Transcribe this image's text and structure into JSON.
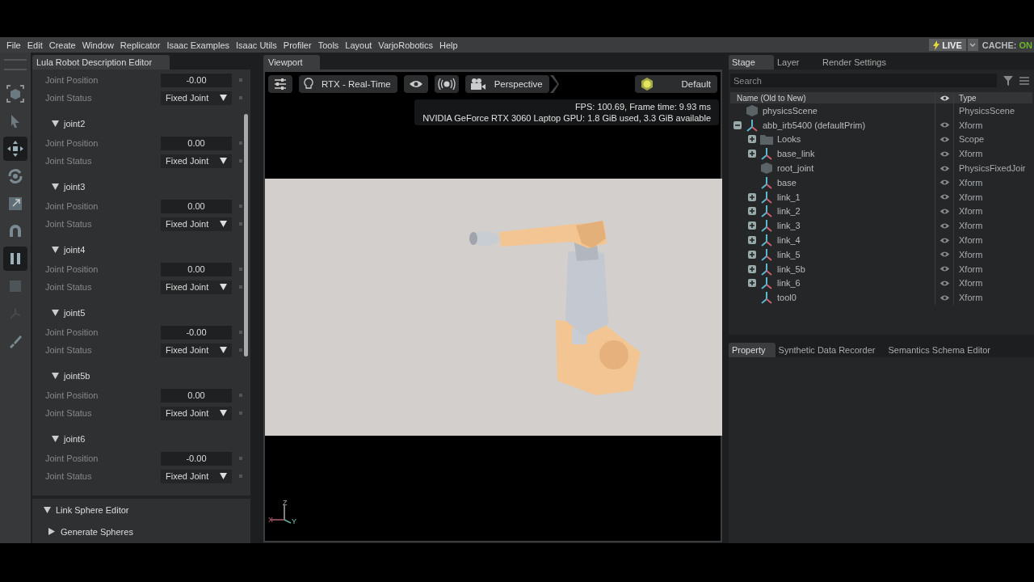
{
  "menu": [
    "File",
    "Edit",
    "Create",
    "Window",
    "Replicator",
    "Isaac Examples",
    "Isaac Utils",
    "Profiler",
    "Tools",
    "Layout",
    "VarjoRobotics",
    "Help"
  ],
  "live": {
    "label": "LIVE",
    "cache_label": "CACHE:",
    "cache_value": "ON"
  },
  "tools": [
    {
      "kind": "frame",
      "selected": false
    },
    {
      "kind": "select",
      "selected": false
    },
    {
      "kind": "move",
      "selected": true
    },
    {
      "kind": "rotate",
      "selected": false
    },
    {
      "kind": "scale",
      "selected": false
    },
    {
      "kind": "snap",
      "selected": false
    },
    {
      "kind": "pause",
      "selected": true
    },
    {
      "kind": "stop",
      "selected": false
    },
    {
      "kind": "joint",
      "selected": false
    },
    {
      "kind": "paint",
      "selected": false
    }
  ],
  "left_panel": {
    "title": "Lula Robot Description Editor",
    "rows": [
      {
        "kind": "number",
        "label": "Joint Position",
        "value": "-0.00"
      },
      {
        "kind": "dropdown",
        "label": "Joint Status",
        "value": "Fixed Joint"
      },
      {
        "kind": "header",
        "label": "joint2",
        "expanded": true
      },
      {
        "kind": "number",
        "label": "Joint Position",
        "value": "0.00"
      },
      {
        "kind": "dropdown",
        "label": "Joint Status",
        "value": "Fixed Joint"
      },
      {
        "kind": "header",
        "label": "joint3",
        "expanded": true
      },
      {
        "kind": "number",
        "label": "Joint Position",
        "value": "0.00"
      },
      {
        "kind": "dropdown",
        "label": "Joint Status",
        "value": "Fixed Joint"
      },
      {
        "kind": "header",
        "label": "joint4",
        "expanded": true
      },
      {
        "kind": "number",
        "label": "Joint Position",
        "value": "0.00"
      },
      {
        "kind": "dropdown",
        "label": "Joint Status",
        "value": "Fixed Joint"
      },
      {
        "kind": "header",
        "label": "joint5",
        "expanded": true
      },
      {
        "kind": "number",
        "label": "Joint Position",
        "value": "-0.00"
      },
      {
        "kind": "dropdown",
        "label": "Joint Status",
        "value": "Fixed Joint"
      },
      {
        "kind": "header",
        "label": "joint5b",
        "expanded": true
      },
      {
        "kind": "number",
        "label": "Joint Position",
        "value": "0.00"
      },
      {
        "kind": "dropdown",
        "label": "Joint Status",
        "value": "Fixed Joint"
      },
      {
        "kind": "header",
        "label": "joint6",
        "expanded": true
      },
      {
        "kind": "number",
        "label": "Joint Position",
        "value": "-0.00"
      },
      {
        "kind": "dropdown",
        "label": "Joint Status",
        "value": "Fixed Joint"
      }
    ],
    "sections": [
      {
        "label": "Link Sphere Editor",
        "expanded": true,
        "children": [
          {
            "label": "Generate Spheres",
            "expanded": false
          }
        ]
      }
    ]
  },
  "viewport": {
    "tab": "Viewport",
    "render_mode": "RTX - Real-Time",
    "camera": "Perspective",
    "lighting": "Default",
    "stats": [
      "FPS: 100.69, Frame time: 9.93 ms",
      "NVIDIA GeForce RTX 3060 Laptop GPU: 1.8 GiB used, 3.3 GiB available"
    ],
    "axes": {
      "z": "Z",
      "x": "X",
      "y": "Y"
    }
  },
  "stage": {
    "tabs": [
      {
        "label": "Stage",
        "selected": true
      },
      {
        "label": "Layer",
        "selected": false
      },
      {
        "label": "Render Settings",
        "selected": false
      }
    ],
    "search": {
      "placeholder": "Search"
    },
    "columns": {
      "name": "Name (Old to New)",
      "type": "Type"
    },
    "tree": [
      {
        "name": "physicsScene",
        "type": "PhysicsScene",
        "kind": "cube",
        "visible": false
      },
      {
        "name": "abb_irb5400 (defaultPrim)",
        "type": "Xform",
        "kind": "xform",
        "visible": true,
        "expanded": true,
        "children": [
          {
            "name": "Looks",
            "type": "Scope",
            "kind": "folder",
            "visible": true,
            "expanded": false
          },
          {
            "name": "base_link",
            "type": "Xform",
            "kind": "xform",
            "visible": true,
            "expanded": false
          },
          {
            "name": "root_joint",
            "type": "PhysicsFixedJoir",
            "kind": "cube",
            "visible": true
          },
          {
            "name": "base",
            "type": "Xform",
            "kind": "xform",
            "visible": true
          },
          {
            "name": "link_1",
            "type": "Xform",
            "kind": "xform",
            "visible": true,
            "expanded": false
          },
          {
            "name": "link_2",
            "type": "Xform",
            "kind": "xform",
            "visible": true,
            "expanded": false
          },
          {
            "name": "link_3",
            "type": "Xform",
            "kind": "xform",
            "visible": true,
            "expanded": false
          },
          {
            "name": "link_4",
            "type": "Xform",
            "kind": "xform",
            "visible": true,
            "expanded": false
          },
          {
            "name": "link_5",
            "type": "Xform",
            "kind": "xform",
            "visible": true,
            "expanded": false
          },
          {
            "name": "link_5b",
            "type": "Xform",
            "kind": "xform",
            "visible": true,
            "expanded": false
          },
          {
            "name": "link_6",
            "type": "Xform",
            "kind": "xform",
            "visible": true,
            "expanded": false
          },
          {
            "name": "tool0",
            "type": "Xform",
            "kind": "xform",
            "visible": true
          }
        ]
      }
    ]
  },
  "property_tabs": [
    {
      "label": "Property",
      "selected": true
    },
    {
      "label": "Synthetic Data Recorder",
      "selected": false
    },
    {
      "label": "Semantics Schema Editor",
      "selected": false
    }
  ]
}
